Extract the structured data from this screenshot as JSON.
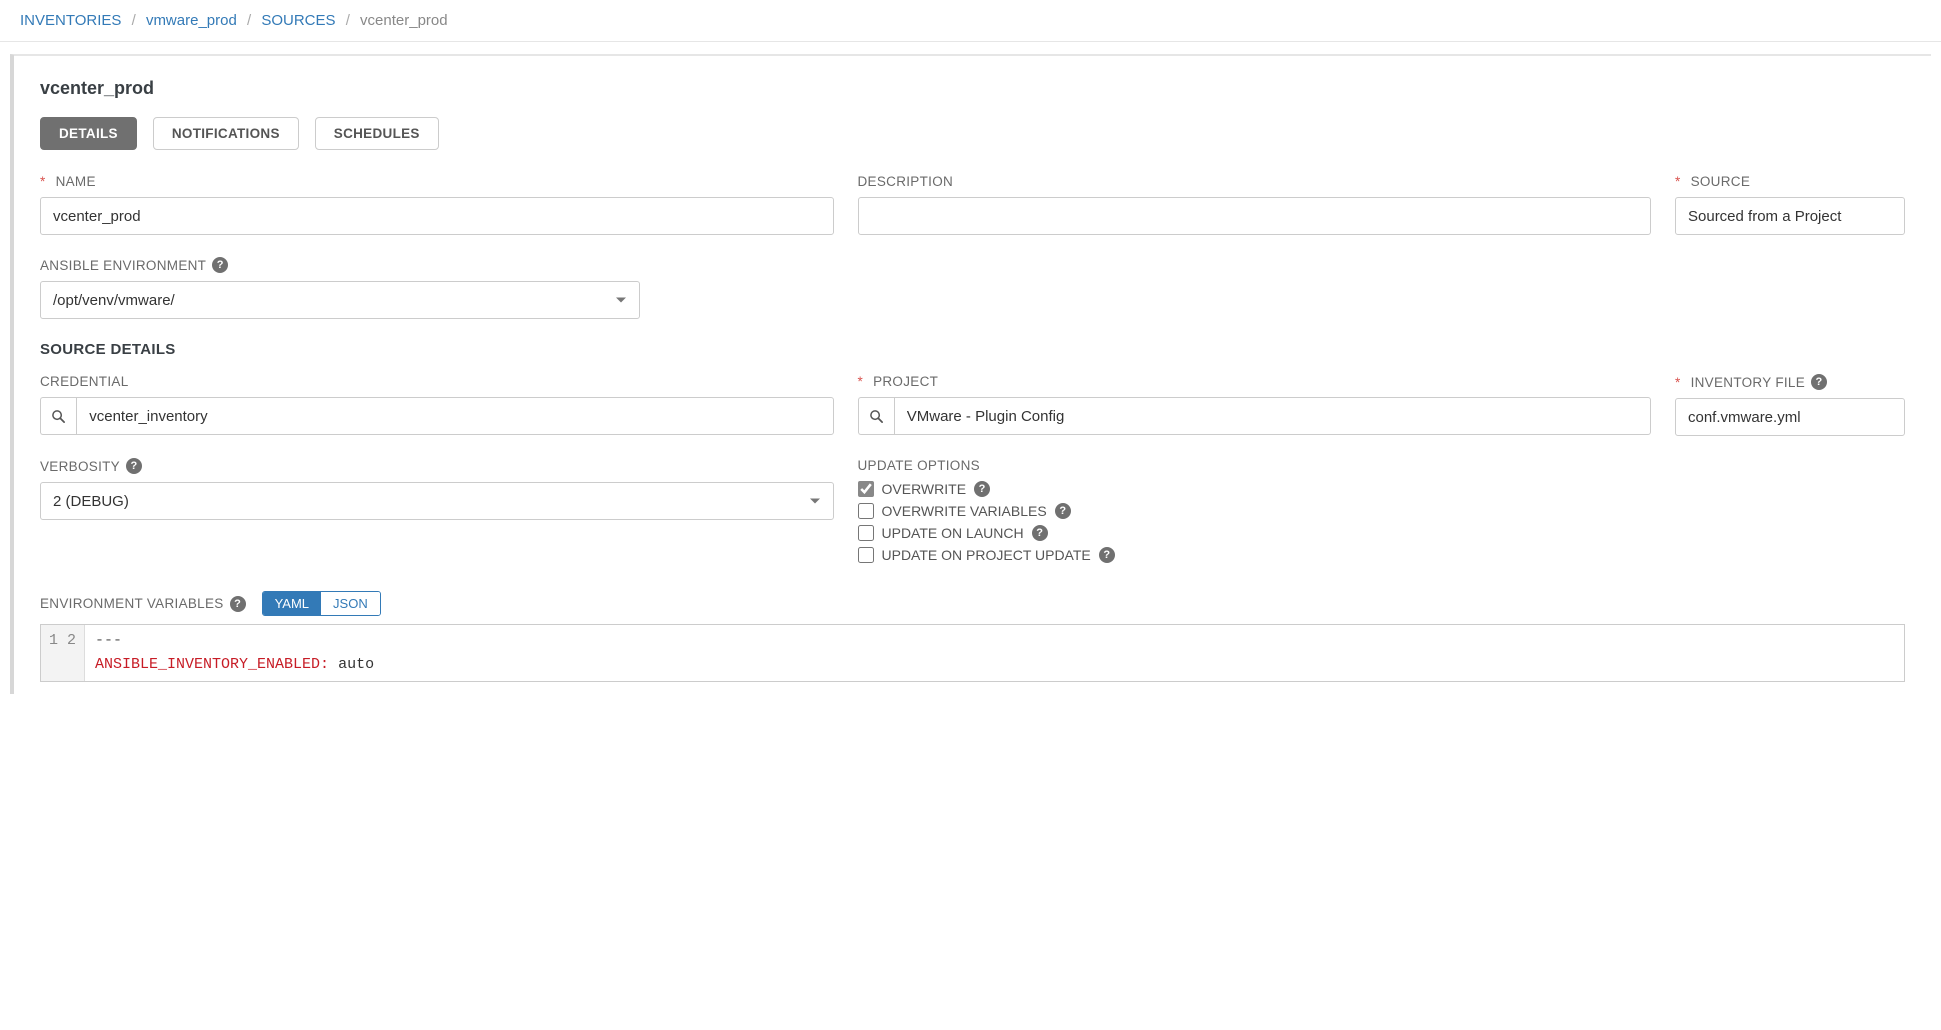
{
  "breadcrumb": {
    "inventories": "INVENTORIES",
    "inventory": "vmware_prod",
    "sources": "SOURCES",
    "current": "vcenter_prod"
  },
  "page_title": "vcenter_prod",
  "tabs": {
    "details": "DETAILS",
    "notifications": "NOTIFICATIONS",
    "schedules": "SCHEDULES"
  },
  "fields": {
    "name": {
      "label": "NAME",
      "value": "vcenter_prod"
    },
    "description": {
      "label": "DESCRIPTION",
      "value": ""
    },
    "source": {
      "label": "SOURCE",
      "value": "Sourced from a Project"
    },
    "ansible_env": {
      "label": "ANSIBLE ENVIRONMENT",
      "value": "/opt/venv/vmware/"
    },
    "credential": {
      "label": "CREDENTIAL",
      "value": "vcenter_inventory"
    },
    "project": {
      "label": "PROJECT",
      "value": "VMware - Plugin Config"
    },
    "inventory_file": {
      "label": "INVENTORY FILE",
      "value": "conf.vmware.yml"
    },
    "verbosity": {
      "label": "VERBOSITY",
      "value": "2 (DEBUG)"
    },
    "update_options": {
      "label": "UPDATE OPTIONS",
      "overwrite": "OVERWRITE",
      "overwrite_vars": "OVERWRITE VARIABLES",
      "update_on_launch": "UPDATE ON LAUNCH",
      "update_on_project": "UPDATE ON PROJECT UPDATE"
    },
    "env_vars": {
      "label": "ENVIRONMENT VARIABLES"
    }
  },
  "section_source_details": "SOURCE DETAILS",
  "toggle": {
    "yaml": "YAML",
    "json": "JSON"
  },
  "code": {
    "line1_marker": "---",
    "line2_key": "ANSIBLE_INVENTORY_ENABLED:",
    "line2_val": " auto"
  }
}
